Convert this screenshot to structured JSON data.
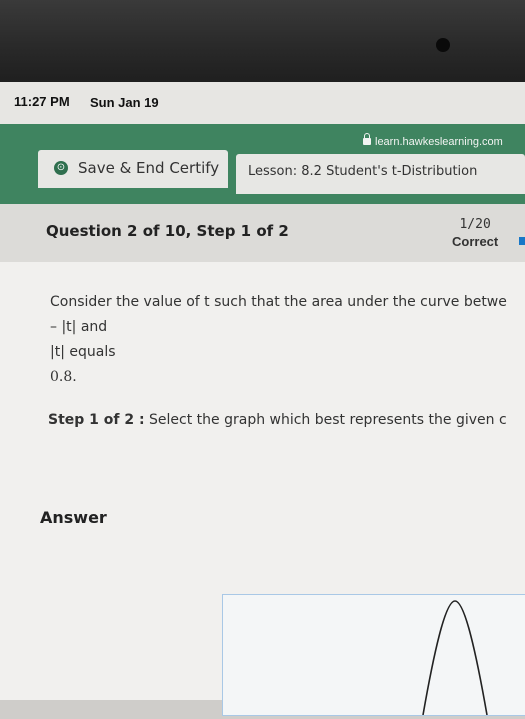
{
  "status_bar": {
    "time": "11:27 PM",
    "date": "Sun Jan 19"
  },
  "browser": {
    "url": "learn.hawkeslearning.com"
  },
  "nav": {
    "save_button_label": "Save & End Certify",
    "lesson_label": "Lesson: 8.2 Student's t-Distribution"
  },
  "question": {
    "title": "Question 2 of 10, Step 1 of 2",
    "score": "1/20",
    "status": "Correct"
  },
  "prompt": {
    "line1": "Consider the value of t such that the area under the curve betwe",
    "line2": "– |t| and",
    "line3": "|t| equals",
    "line4": "0.8."
  },
  "step": {
    "label": "Step 1 of 2 :",
    "text": " Select the graph which best represents the given c"
  },
  "answer": {
    "label": "Answer"
  },
  "colors": {
    "nav_green": "#3f8460",
    "correct_marker": "#1877c7"
  }
}
